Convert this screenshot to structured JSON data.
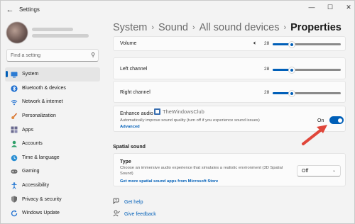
{
  "window": {
    "app_title": "Settings"
  },
  "search": {
    "placeholder": "Find a setting"
  },
  "nav": [
    {
      "label": "System",
      "icon": "display-icon",
      "active": true
    },
    {
      "label": "Bluetooth & devices",
      "icon": "bluetooth-icon"
    },
    {
      "label": "Network & internet",
      "icon": "wifi-icon"
    },
    {
      "label": "Personalization",
      "icon": "brush-icon"
    },
    {
      "label": "Apps",
      "icon": "apps-icon"
    },
    {
      "label": "Accounts",
      "icon": "person-icon"
    },
    {
      "label": "Time & language",
      "icon": "globe-clock-icon"
    },
    {
      "label": "Gaming",
      "icon": "gamepad-icon"
    },
    {
      "label": "Accessibility",
      "icon": "accessibility-icon"
    },
    {
      "label": "Privacy & security",
      "icon": "shield-icon"
    },
    {
      "label": "Windows Update",
      "icon": "update-icon"
    }
  ],
  "breadcrumb": {
    "items": [
      "System",
      "Sound",
      "All sound devices"
    ],
    "current": "Properties",
    "separator": "›"
  },
  "volume": {
    "label": "Volume",
    "value": "28",
    "level": 0.28
  },
  "left_channel": {
    "label": "Left channel",
    "value": "28",
    "level": 0.28
  },
  "right_channel": {
    "label": "Right channel",
    "value": "28",
    "level": 0.28
  },
  "enhance": {
    "title": "Enhance audio",
    "description": "Automatically improve sound quality (turn off if you experience sound issues)",
    "link": "Advanced",
    "state_label": "On",
    "enabled": true
  },
  "watermark": "TheWindowsClub",
  "spatial": {
    "section_title": "Spatial sound",
    "type_title": "Type",
    "description": "Choose an immersive audio experience that simulates a realistic environment (3D Spatial Sound)",
    "link": "Get more spatial sound apps from Microsoft Store",
    "selected": "Off"
  },
  "footer": {
    "help": "Get help",
    "feedback": "Give feedback"
  },
  "colors": {
    "accent": "#005fb8",
    "arrow": "#e0463a"
  }
}
